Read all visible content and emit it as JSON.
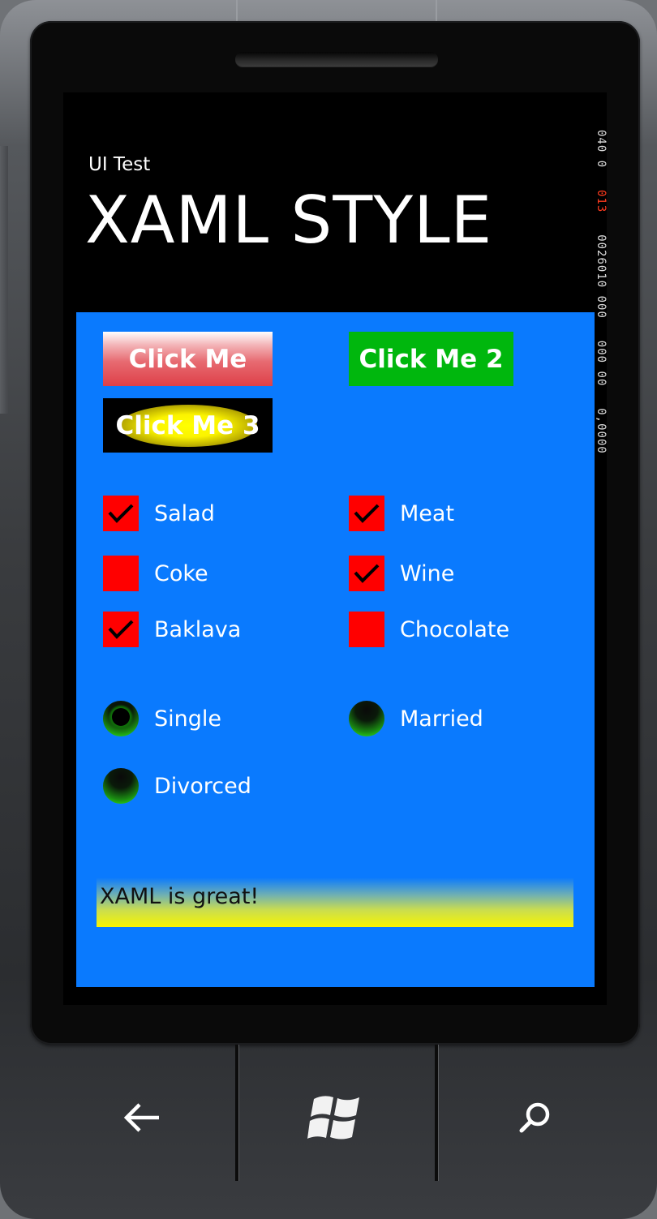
{
  "app": {
    "title": "UI Test",
    "page_title": "XAML STYLE"
  },
  "debug_counters": {
    "line1": "040 0",
    "line2": "013",
    "line3": "0026010 000",
    "line4": "000 00",
    "line5": "0,0000"
  },
  "buttons": [
    {
      "label": "Click Me"
    },
    {
      "label": "Click Me 2"
    },
    {
      "label": "Click Me 3"
    }
  ],
  "checkboxes": [
    {
      "label": "Salad",
      "checked": true
    },
    {
      "label": "Meat",
      "checked": true
    },
    {
      "label": "Coke",
      "checked": false
    },
    {
      "label": "Wine",
      "checked": true
    },
    {
      "label": "Baklava",
      "checked": true
    },
    {
      "label": "Chocolate",
      "checked": false
    }
  ],
  "radios": [
    {
      "label": "Single",
      "selected": true
    },
    {
      "label": "Married",
      "selected": false
    },
    {
      "label": "Divorced",
      "selected": false
    }
  ],
  "textbox": {
    "value": "XAML is great!"
  },
  "nav_buttons": [
    {
      "icon": "back-arrow-icon"
    },
    {
      "icon": "windows-logo-icon"
    },
    {
      "icon": "search-icon"
    }
  ],
  "colors": {
    "content_bg": "#0a7afe",
    "checkbox_bg": "#ff0000",
    "button2_bg": "#00b70d",
    "radio_highlight": "#33ff1a",
    "textbox_gradient_end": "#f8f400"
  }
}
